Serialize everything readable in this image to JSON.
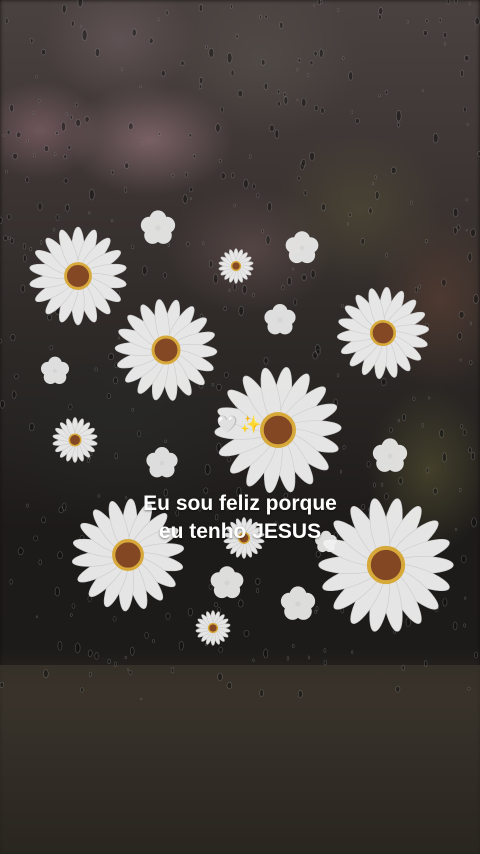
{
  "caption": {
    "emoji_heart": "🤍",
    "emoji_sparkles": "✨",
    "line1": "Eu sou feliz porque",
    "line2": "eu tenho JESUS"
  },
  "colors": {
    "petal": "#f2f2f2",
    "flower_center": "#8a4a24",
    "text": "#ffffff"
  }
}
